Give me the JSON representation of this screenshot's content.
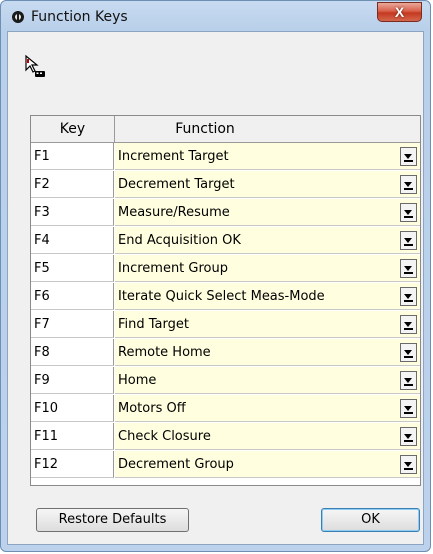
{
  "window": {
    "title": "Function Keys",
    "close_label": "X"
  },
  "header": {
    "key": "Key",
    "function": "Function"
  },
  "rows": [
    {
      "key": "F1",
      "function": "Increment Target"
    },
    {
      "key": "F2",
      "function": "Decrement Target"
    },
    {
      "key": "F3",
      "function": "Measure/Resume"
    },
    {
      "key": "F4",
      "function": "End Acquisition OK"
    },
    {
      "key": "F5",
      "function": "Increment Group"
    },
    {
      "key": "F6",
      "function": "Iterate Quick Select Meas-Mode"
    },
    {
      "key": "F7",
      "function": "Find Target"
    },
    {
      "key": "F8",
      "function": "Remote Home"
    },
    {
      "key": "F9",
      "function": "Home"
    },
    {
      "key": "F10",
      "function": "Motors Off"
    },
    {
      "key": "F11",
      "function": "Check Closure"
    },
    {
      "key": "F12",
      "function": "Decrement Group"
    }
  ],
  "buttons": {
    "restore": "Restore Defaults",
    "ok": "OK"
  },
  "icons": {
    "title": "app-icon",
    "toolbar": "pointer-keyboard-icon",
    "dropdown": "chevron-down-icon"
  },
  "colors": {
    "function_bg": "#ffffe0",
    "titlebar": "#b9d0ea",
    "close": "#c4381f"
  }
}
